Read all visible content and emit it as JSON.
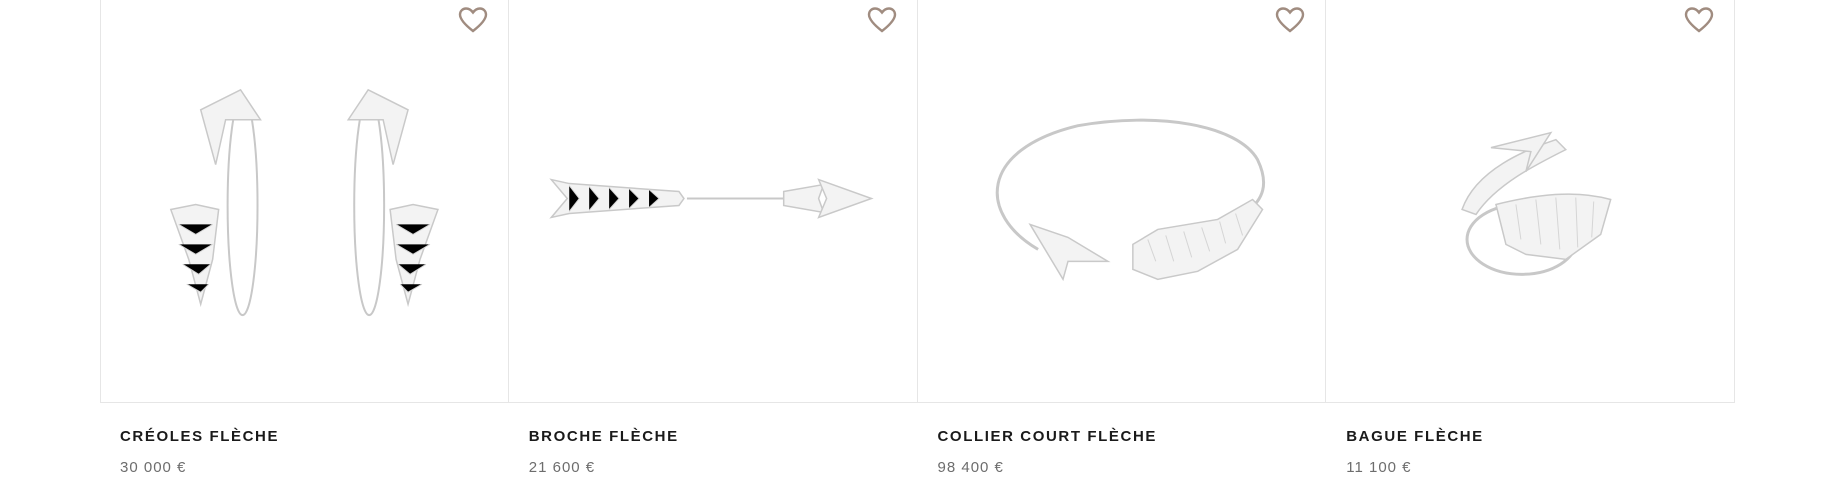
{
  "products": [
    {
      "name": "CRÉOLES FLÈCHE",
      "price": "30 000 €",
      "icon": "heart-outline-icon"
    },
    {
      "name": "BROCHE FLÈCHE",
      "price": "21 600 €",
      "icon": "heart-outline-icon"
    },
    {
      "name": "COLLIER COURT FLÈCHE",
      "price": "98 400 €",
      "icon": "heart-outline-icon"
    },
    {
      "name": "BAGUE FLÈCHE",
      "price": "11 100 €",
      "icon": "heart-outline-icon"
    }
  ],
  "colors": {
    "heart": "#a08c80",
    "text": "#1a1a1a",
    "price": "#6d6d6d",
    "border": "#e6e6e6"
  }
}
